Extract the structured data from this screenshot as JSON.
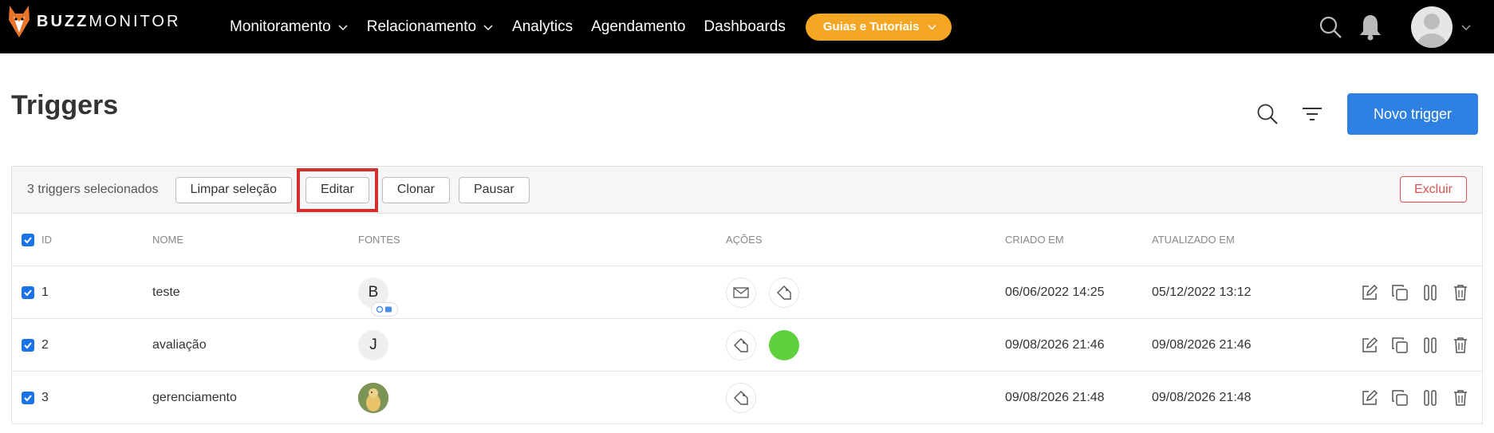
{
  "brand": {
    "logo_bold": "BUZZ",
    "logo_light": "MONITOR"
  },
  "nav": {
    "items": [
      {
        "label": "Monitoramento",
        "has_dropdown": true
      },
      {
        "label": "Relacionamento",
        "has_dropdown": true
      },
      {
        "label": "Analytics",
        "has_dropdown": false
      },
      {
        "label": "Agendamento",
        "has_dropdown": false
      },
      {
        "label": "Dashboards",
        "has_dropdown": false
      }
    ],
    "guides_label": "Guias e Tutoriais",
    "guides_color": "#f5a623"
  },
  "page": {
    "title": "Triggers",
    "new_button": "Novo trigger",
    "primary_color": "#2f80e3"
  },
  "selection_bar": {
    "text": "3 triggers selecionados",
    "clear_label": "Limpar seleção",
    "edit_label": "Editar",
    "clone_label": "Clonar",
    "pause_label": "Pausar",
    "delete_label": "Excluir"
  },
  "table": {
    "columns": {
      "id": "ID",
      "name": "NOME",
      "sources": "FONTES",
      "actions": "AÇÕES",
      "created": "CRIADO EM",
      "updated": "ATUALIZADO EM"
    },
    "rows": [
      {
        "id": "1",
        "name": "teste",
        "source_letter": "B",
        "created": "06/06/2022 14:25",
        "updated": "05/12/2022 13:12"
      },
      {
        "id": "2",
        "name": "avaliação",
        "source_letter": "J",
        "created": "09/08/2026 21:46",
        "updated": "09/08/2026 21:46"
      },
      {
        "id": "3",
        "name": "gerenciamento",
        "source_letter": "",
        "created": "09/08/2026 21:48",
        "updated": "09/08/2026 21:48"
      }
    ]
  },
  "icons": {
    "search": "search-icon",
    "bell": "bell-icon",
    "filter": "filter-icon",
    "mail": "mail-icon",
    "tag": "tag-icon",
    "edit": "edit-icon",
    "clone": "clone-icon",
    "pause": "pause-icon",
    "trash": "trash-icon"
  }
}
